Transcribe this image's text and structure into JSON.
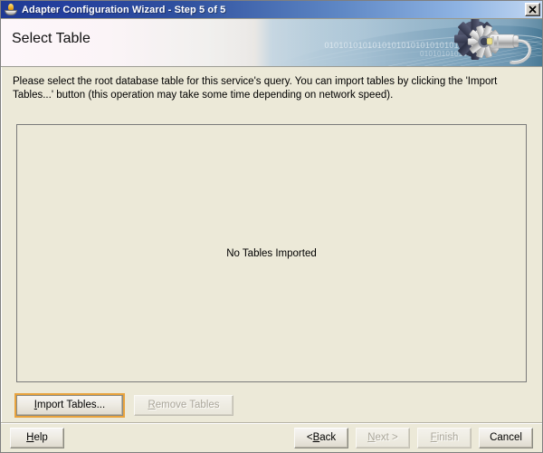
{
  "window": {
    "title": "Adapter Configuration Wizard - Step 5 of 5",
    "icon": "adapter-flame-icon",
    "close_label": "✕"
  },
  "banner": {
    "heading": "Select Table",
    "decor_icon": "gear-plug-icon",
    "binary_text_top": "0101010101010101010101010101",
    "binary_text_bottom": "010101010101"
  },
  "main": {
    "instructions": "Please select the root database table for this service's query.  You can import tables by clicking the 'Import Tables...' button (this operation may take some time depending on network speed).",
    "table_panel": {
      "empty_message": "No Tables Imported",
      "rows": []
    },
    "panel_buttons": [
      {
        "id": "import-tables",
        "label": "Import Tables...",
        "mnemonic": "I",
        "enabled": true,
        "focused": true
      },
      {
        "id": "remove-tables",
        "label": "Remove Tables",
        "mnemonic": "R",
        "enabled": false,
        "focused": false
      }
    ]
  },
  "footer": {
    "help": {
      "label": "Help",
      "mnemonic": "H",
      "enabled": true
    },
    "back": {
      "label": "< Back",
      "mnemonic": "B",
      "enabled": true
    },
    "next": {
      "label": "Next >",
      "mnemonic": "N",
      "enabled": false
    },
    "finish": {
      "label": "Finish",
      "mnemonic": "F",
      "enabled": false
    },
    "cancel": {
      "label": "Cancel",
      "mnemonic": "",
      "enabled": true
    }
  },
  "colors": {
    "titlebar_start": "#1f3a93",
    "titlebar_end": "#c3d8f2",
    "dialog_face": "#ece9d8",
    "focus_ring": "#e8a33d",
    "panel_border": "#7a7a7a",
    "banner_blue": "#4a7a96"
  }
}
